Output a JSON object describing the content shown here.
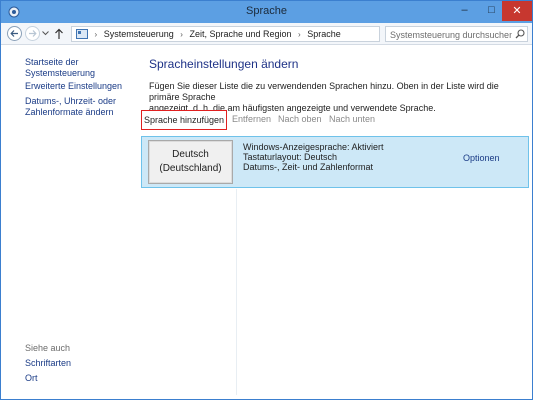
{
  "window": {
    "title": "Sprache",
    "controls": {
      "minimize": "–",
      "maximize": "□",
      "close": "✕"
    }
  },
  "addressbar": {
    "breadcrumbs": [
      "Systemsteuerung",
      "Zeit, Sprache und Region",
      "Sprache"
    ],
    "separator": "›",
    "search_placeholder": "Systemsteuerung durchsuchen"
  },
  "sidebar": {
    "home_link": "Startseite der Systemsteuerung",
    "links": [
      "Erweiterte Einstellungen",
      "Datums-, Uhrzeit- oder",
      "Zahlenformate ändern"
    ],
    "see_also_label": "Siehe auch",
    "see_also": [
      "Schriftarten",
      "Ort"
    ]
  },
  "main": {
    "title": "Spracheinstellungen ändern",
    "description_line1": "Fügen Sie dieser Liste die zu verwendenden Sprachen hinzu. Oben in der Liste wird die primäre Sprache",
    "description_line2": "angezeigt, d. h. die am häufigsten angezeigte und verwendete Sprache.",
    "toolbar": {
      "add": "Sprache hinzufügen",
      "remove": "Entfernen",
      "move_up": "Nach oben",
      "move_down": "Nach unten"
    },
    "languages": [
      {
        "name_line1": "Deutsch",
        "name_line2": "(Deutschland)",
        "info": [
          "Windows-Anzeigesprache: Aktiviert",
          "Tastaturlayout: Deutsch",
          "Datums-, Zeit- und Zahlenformat"
        ],
        "options": "Optionen"
      }
    ]
  },
  "colors": {
    "selection_bg": "#cde8f7",
    "selection_border": "#6fc2ea",
    "link": "#1a3b86",
    "highlight_border": "#e02020"
  }
}
